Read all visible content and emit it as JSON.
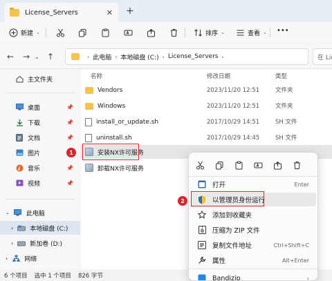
{
  "tab": {
    "title": "License_Servers",
    "close": "✕",
    "new": "+"
  },
  "toolbar": {
    "new_label": "新建",
    "sort_label": "排序",
    "view_label": "查看",
    "more": "•••"
  },
  "nav": {
    "back": "←",
    "forward": "→",
    "up": "↑",
    "refresh": "↻"
  },
  "address": {
    "crumbs": [
      "此电脑",
      "本地磁盘 (C:)",
      "License_Servers"
    ],
    "search_placeholder": "在 Lic"
  },
  "sidebar": {
    "home": "主文件夹",
    "quick": [
      "桌面",
      "下载",
      "文档",
      "图片",
      "音乐",
      "视频"
    ],
    "this_pc": "此电脑",
    "drives": [
      "本地磁盘 (C:)",
      "新加卷 (D:)"
    ],
    "network": "网络"
  },
  "columns": {
    "name": "名称",
    "date": "修改日期",
    "type": "类型"
  },
  "files": [
    {
      "name": "Vendors",
      "date": "2023/11/20 12:51",
      "type": "文件夹",
      "kind": "folder"
    },
    {
      "name": "Windows",
      "date": "2023/11/20 12:51",
      "type": "文件夹",
      "kind": "folder"
    },
    {
      "name": "install_or_update.sh",
      "date": "2017/10/29 14:51",
      "type": "SH 文件",
      "kind": "file"
    },
    {
      "name": "uninstall.sh",
      "date": "2017/10/29 14:45",
      "type": "SH 文件",
      "kind": "file"
    },
    {
      "name": "安装NX许可服务",
      "date": "",
      "type": "",
      "kind": "prog"
    },
    {
      "name": "卸载NX许可服务",
      "date": "",
      "type": "",
      "kind": "prog"
    }
  ],
  "badges": {
    "one": "1",
    "two": "2"
  },
  "status": {
    "count": "6 个项目",
    "selected": "选中 1 个项目",
    "size": "826 字节"
  },
  "context_menu": {
    "items": [
      {
        "label": "打开",
        "shortcut": "Enter"
      },
      {
        "label": "以管理员身份运行",
        "shortcut": ""
      },
      {
        "label": "添加到收藏夹",
        "shortcut": ""
      },
      {
        "label": "压缩为 ZIP 文件",
        "shortcut": ""
      },
      {
        "label": "复制文件地址",
        "shortcut": "Ctrl+Shift+C"
      },
      {
        "label": "属性",
        "shortcut": "Alt+Enter"
      },
      {
        "label": "Bandizip",
        "shortcut": ""
      }
    ]
  },
  "colors": {
    "accent": "#0067c0",
    "highlight_red": "#d9262c",
    "folder": "#f4c44e"
  }
}
